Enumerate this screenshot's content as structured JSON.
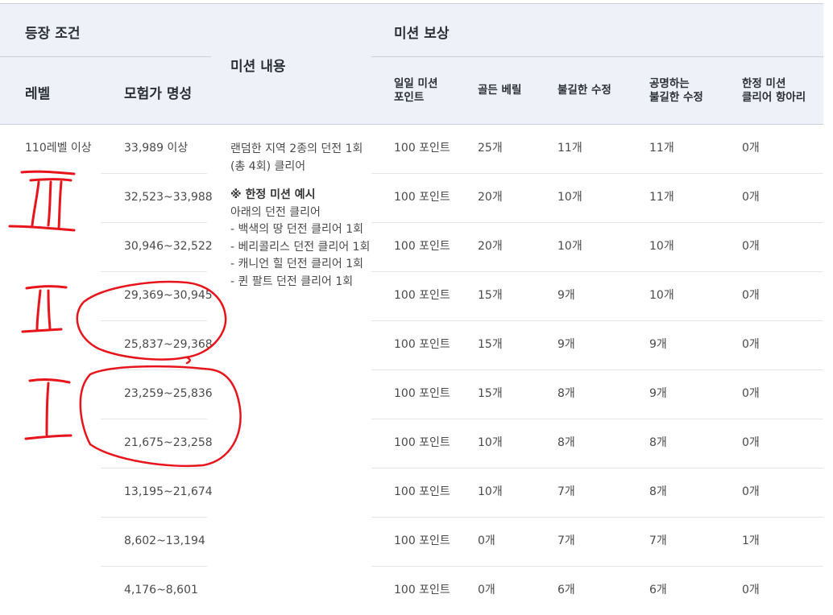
{
  "header": {
    "appearance_conditions": "등장 조건",
    "mission_rewards": "미션 보상",
    "mission_content": "미션 내용",
    "level": "레벨",
    "adventurer_fame": "모험가 명성",
    "reward_columns": [
      "일일 미션\n포인트",
      "골든 베릴",
      "불길한 수정",
      "공명하는\n불길한 수정",
      "한정 미션\n클리어 항아리"
    ]
  },
  "level_value": "110레벨 이상",
  "mission": {
    "line1": "랜덤한 지역 2종의 던전 1회",
    "line2": "(총 4회) 클리어",
    "example_title": "※ 한정 미션 예시",
    "example_intro": "아래의 던전 클리어",
    "examples": [
      "- 백색의 땅 던전 클리어 1회",
      "- 베리콜리스 던전 클리어 1회",
      "- 캐니언 힐 던전 클리어 1회",
      "- 퀸 팔트 던전 클리어 1회"
    ]
  },
  "rows": [
    {
      "fame": "33,989 이상",
      "points": "100 포인트",
      "beryl": "25개",
      "crystal": "11개",
      "resonant": "11개",
      "jar": "0개"
    },
    {
      "fame": "32,523~33,988",
      "points": "100 포인트",
      "beryl": "20개",
      "crystal": "10개",
      "resonant": "11개",
      "jar": "0개"
    },
    {
      "fame": "30,946~32,522",
      "points": "100 포인트",
      "beryl": "20개",
      "crystal": "10개",
      "resonant": "10개",
      "jar": "0개"
    },
    {
      "fame": "29,369~30,945",
      "points": "100 포인트",
      "beryl": "15개",
      "crystal": "9개",
      "resonant": "10개",
      "jar": "0개"
    },
    {
      "fame": "25,837~29,368",
      "points": "100 포인트",
      "beryl": "15개",
      "crystal": "9개",
      "resonant": "9개",
      "jar": "0개"
    },
    {
      "fame": "23,259~25,836",
      "points": "100 포인트",
      "beryl": "15개",
      "crystal": "8개",
      "resonant": "9개",
      "jar": "0개"
    },
    {
      "fame": "21,675~23,258",
      "points": "100 포인트",
      "beryl": "10개",
      "crystal": "8개",
      "resonant": "8개",
      "jar": "0개"
    },
    {
      "fame": "13,195~21,674",
      "points": "100 포인트",
      "beryl": "10개",
      "crystal": "7개",
      "resonant": "8개",
      "jar": "0개"
    },
    {
      "fame": "8,602~13,194",
      "points": "100 포인트",
      "beryl": "0개",
      "crystal": "7개",
      "resonant": "7개",
      "jar": "1개"
    },
    {
      "fame": "4,176~8,601",
      "points": "100 포인트",
      "beryl": "0개",
      "crystal": "6개",
      "resonant": "6개",
      "jar": "0개"
    }
  ],
  "annotation_color": "#e8141c"
}
